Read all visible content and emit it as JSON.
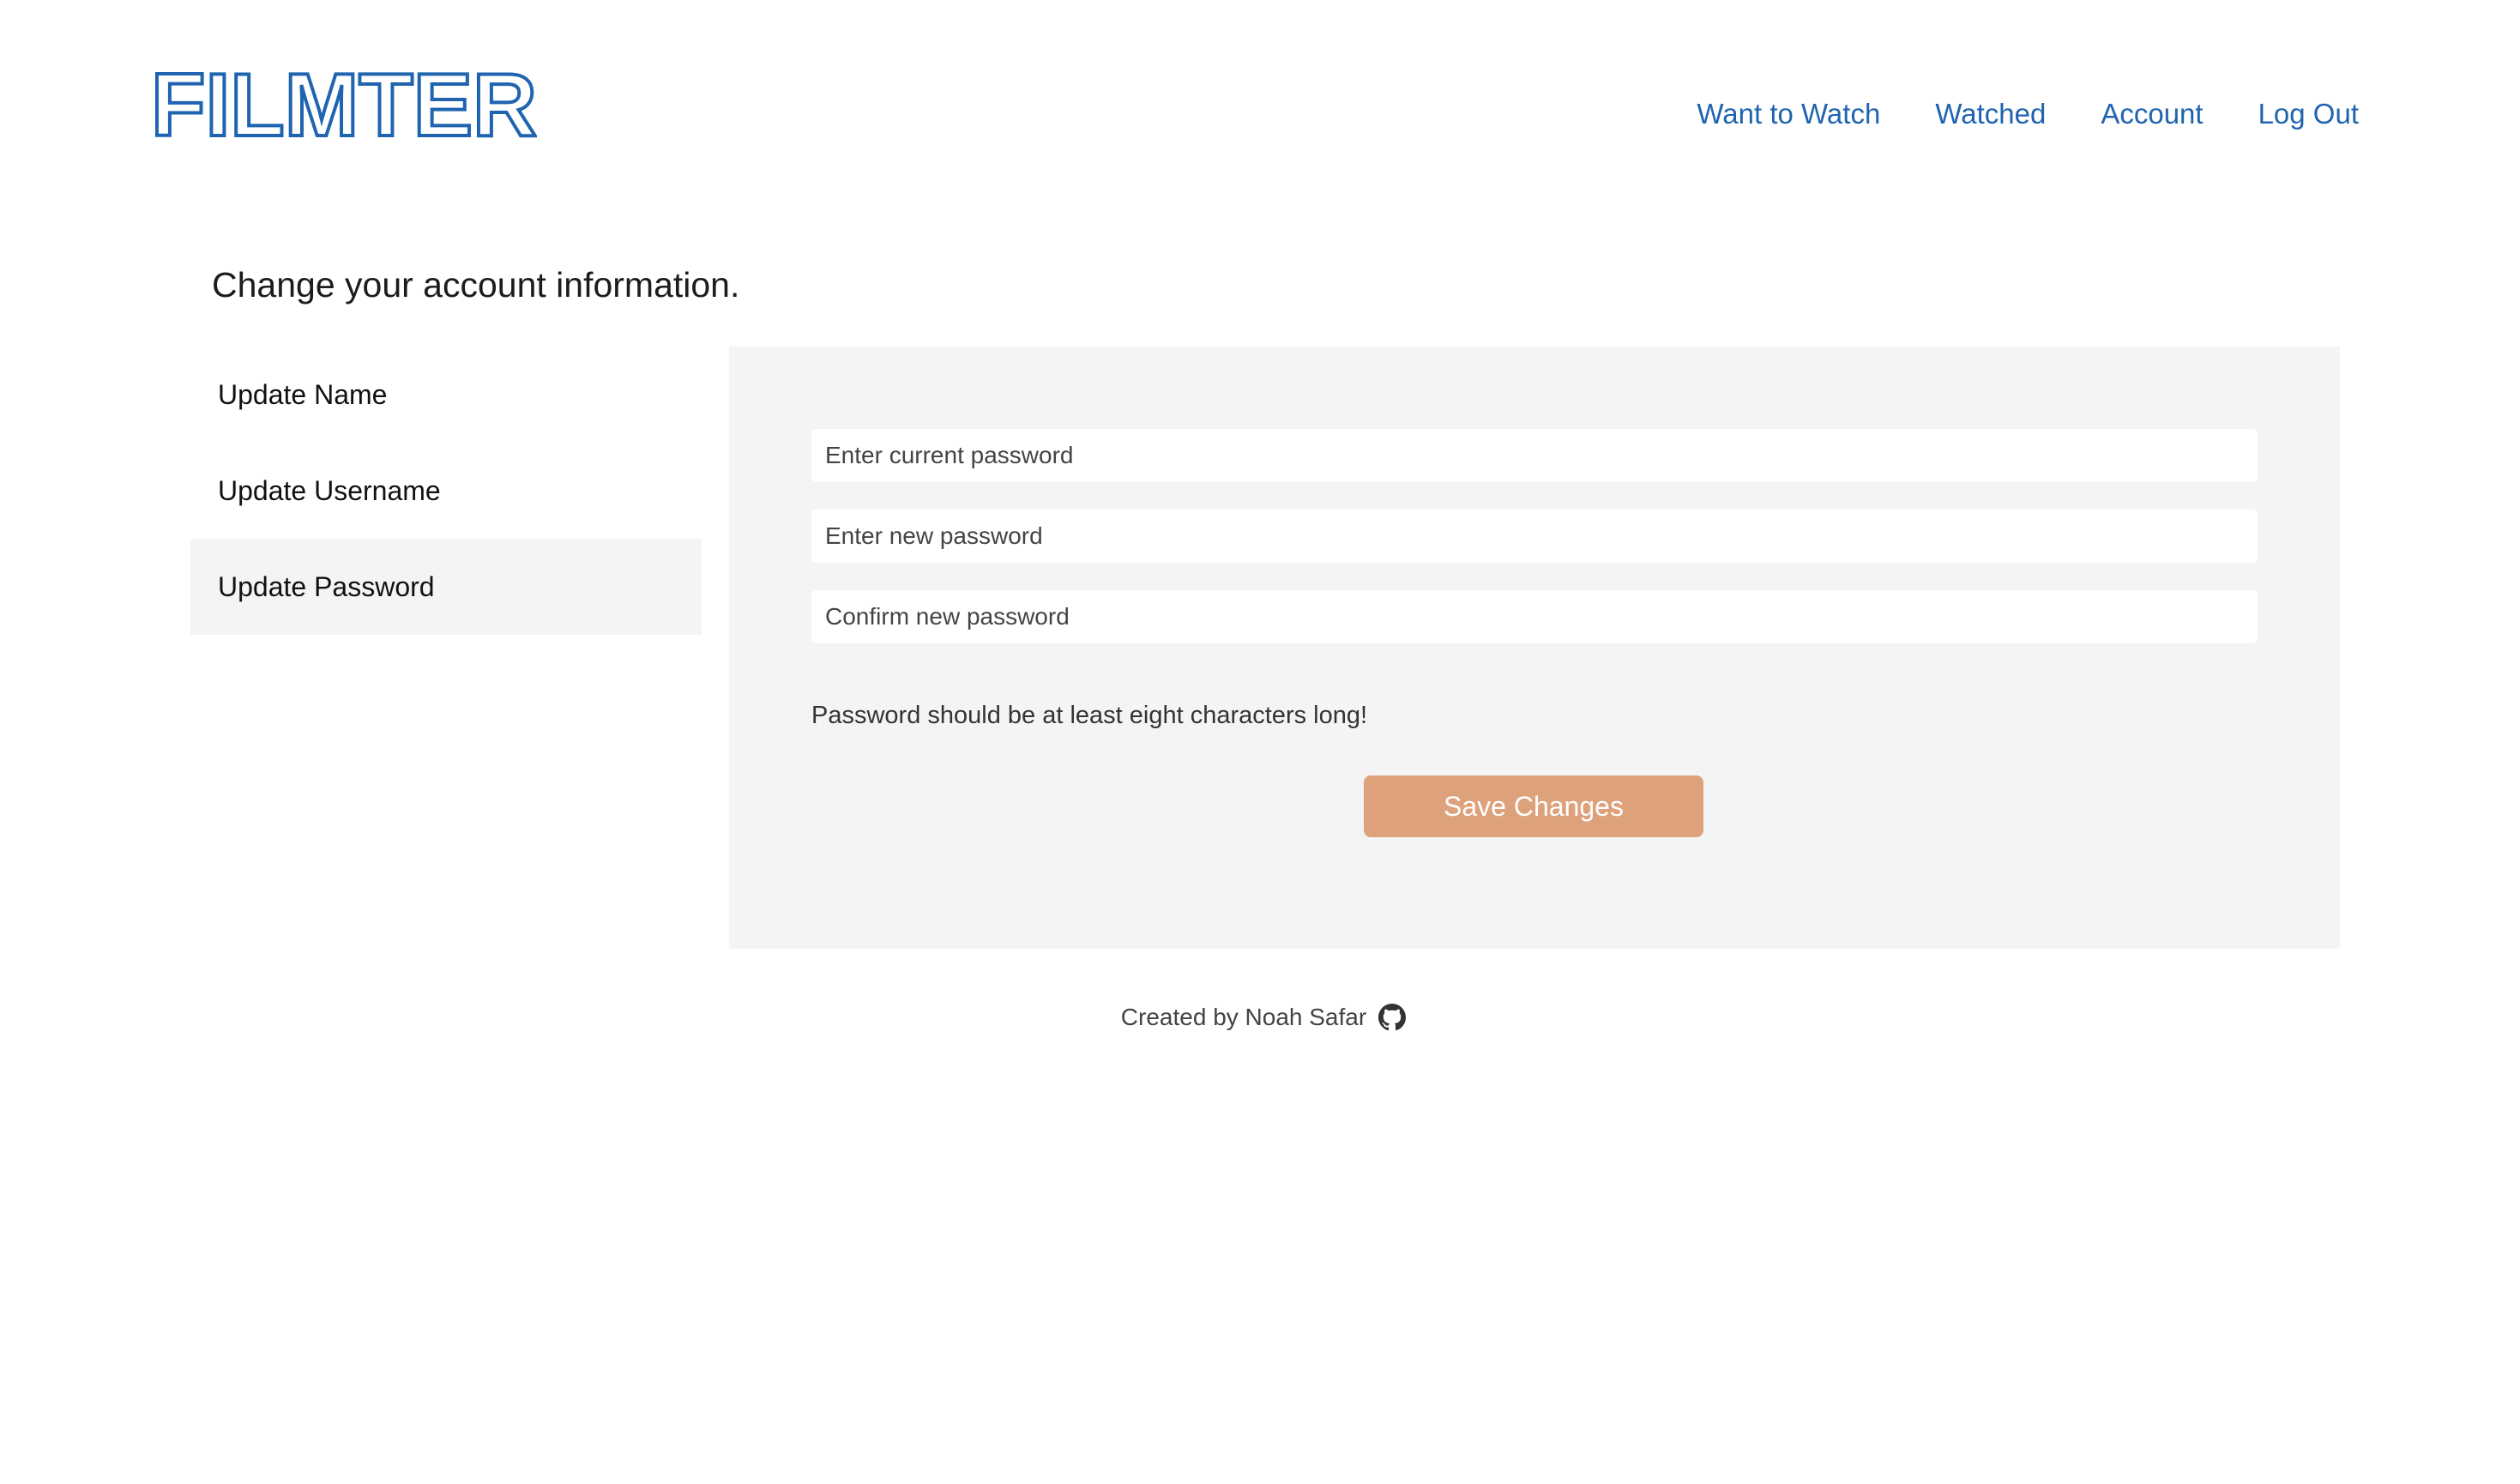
{
  "brand": {
    "logo_text": "FILMTER",
    "color": "#1f64b0"
  },
  "nav": {
    "items": [
      {
        "label": "Want to Watch"
      },
      {
        "label": "Watched"
      },
      {
        "label": "Account"
      },
      {
        "label": "Log Out"
      }
    ]
  },
  "page": {
    "title": "Change your account information."
  },
  "sidebar": {
    "items": [
      {
        "label": "Update Name",
        "active": false
      },
      {
        "label": "Update Username",
        "active": false
      },
      {
        "label": "Update Password",
        "active": true
      }
    ]
  },
  "form": {
    "current_password": {
      "placeholder": "Enter current password",
      "value": ""
    },
    "new_password": {
      "placeholder": "Enter new password",
      "value": ""
    },
    "confirm_password": {
      "placeholder": "Confirm new password",
      "value": ""
    },
    "hint": "Password should be at least eight characters long!",
    "save_label": "Save Changes"
  },
  "footer": {
    "text": "Created by Noah Safar",
    "icon": "github-icon"
  },
  "colors": {
    "accent": "#1f64b0",
    "button": "#dda27b",
    "panel": "#f4f4f4"
  }
}
